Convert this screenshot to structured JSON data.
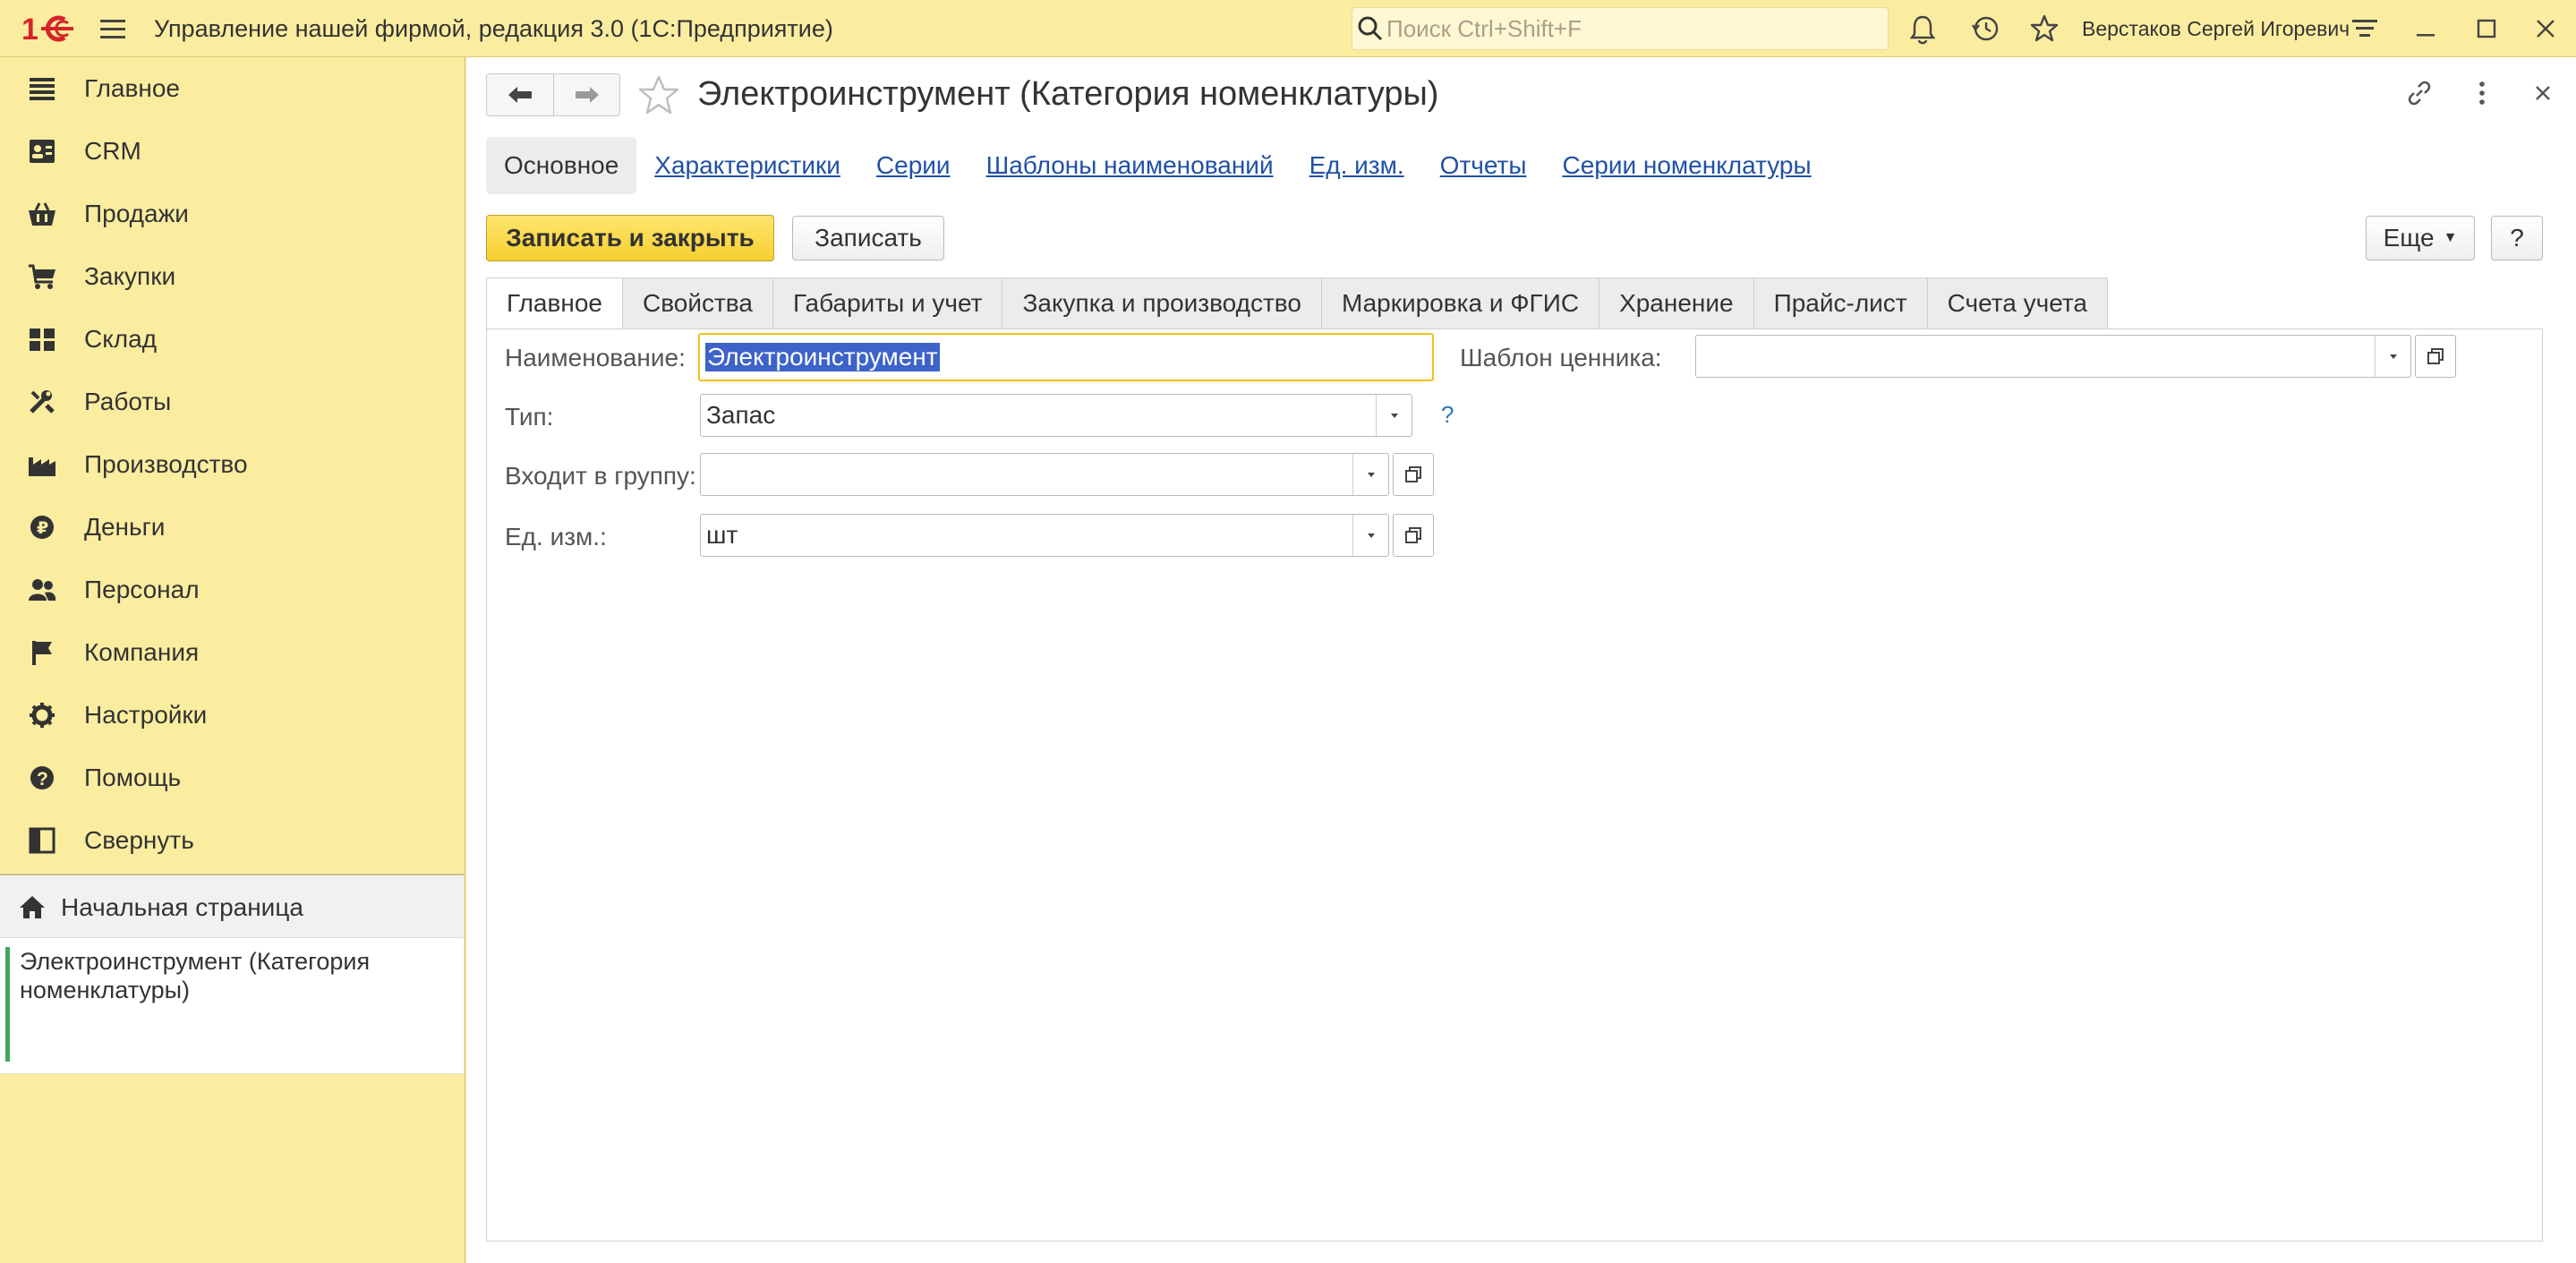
{
  "topbar": {
    "app_title": "Управление нашей фирмой, редакция 3.0  (1С:Предприятие)",
    "search_placeholder": "Поиск Ctrl+Shift+F",
    "user_name": "Верстаков Сергей Игоревич",
    "icons": [
      "logo-1c-icon",
      "menu-icon",
      "search-icon",
      "bell-icon",
      "history-icon",
      "star-icon",
      "settings-lines-icon",
      "minimize-icon",
      "maximize-icon",
      "close-icon"
    ]
  },
  "sidebar": {
    "items": [
      {
        "label": "Главное",
        "icon": "list-icon"
      },
      {
        "label": "CRM",
        "icon": "contacts-icon"
      },
      {
        "label": "Продажи",
        "icon": "basket-icon"
      },
      {
        "label": "Закупки",
        "icon": "cart-icon"
      },
      {
        "label": "Склад",
        "icon": "warehouse-icon"
      },
      {
        "label": "Работы",
        "icon": "tools-icon"
      },
      {
        "label": "Производство",
        "icon": "factory-icon"
      },
      {
        "label": "Деньги",
        "icon": "ruble-icon"
      },
      {
        "label": "Персонал",
        "icon": "people-icon"
      },
      {
        "label": "Компания",
        "icon": "flag-icon"
      },
      {
        "label": "Настройки",
        "icon": "gear-icon"
      },
      {
        "label": "Помощь",
        "icon": "help-icon"
      },
      {
        "label": "Свернуть",
        "icon": "collapse-icon"
      }
    ],
    "home_label": "Начальная страница",
    "open_window_label": "Электроинструмент (Категория номенклатуры)"
  },
  "form": {
    "title": "Электроинструмент (Категория номенклатуры)",
    "panel_tabs": [
      "Основное",
      "Характеристики",
      "Серии",
      "Шаблоны наименований",
      "Ед. изм.",
      "Отчеты",
      "Серии номенклатуры"
    ],
    "buttons": {
      "save_close": "Записать и закрыть",
      "save": "Записать",
      "more": "Еще",
      "help": "?"
    },
    "tabs": [
      "Главное",
      "Свойства",
      "Габариты и учет",
      "Закупка и производство",
      "Маркировка и ФГИС",
      "Хранение",
      "Прайс-лист",
      "Счета учета"
    ],
    "fields": {
      "name_label": "Наименование:",
      "name_value": "Электроинструмент",
      "type_label": "Тип:",
      "type_value": "Запас",
      "type_help": "?",
      "group_label": "Входит в группу:",
      "group_value": "",
      "unit_label": "Ед. изм.:",
      "unit_value": "шт",
      "price_tag_label": "Шаблон ценника:",
      "price_tag_value": ""
    }
  },
  "colors": {
    "panel_bg": "#fbeda0",
    "primary_button": "#fcd94c",
    "link": "#2151a6",
    "selection": "#3d63c9",
    "active_window_bar": "#3ea85b"
  }
}
